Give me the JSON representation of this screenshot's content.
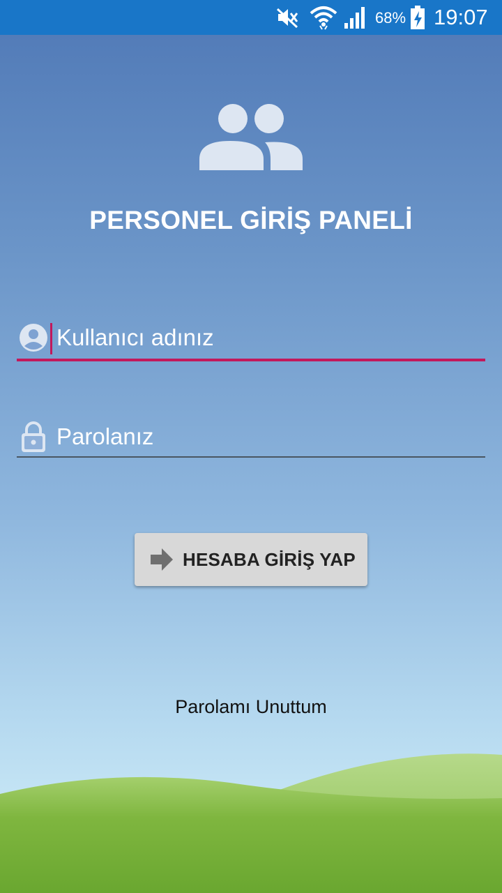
{
  "status_bar": {
    "battery_percent": "68%",
    "time": "19:07",
    "icons": [
      "mute-icon",
      "wifi-icon",
      "signal-icon",
      "battery-charging-icon"
    ]
  },
  "header": {
    "icon": "group-icon",
    "title": "PERSONEL GİRİŞ PANELİ"
  },
  "form": {
    "username": {
      "placeholder": "Kullanıcı adınız",
      "value": "",
      "icon": "account-circle-icon"
    },
    "password": {
      "placeholder": "Parolanız",
      "value": "",
      "icon": "lock-icon"
    },
    "login_button": {
      "label": "HESABA GİRİŞ YAP",
      "icon": "arrow-right-icon"
    },
    "forgot_password": "Parolamı Unuttum"
  },
  "colors": {
    "status_bar": "#1976c8",
    "accent": "#c2185b",
    "button_bg": "#d8d8d8",
    "grass": "#7ab33a"
  }
}
